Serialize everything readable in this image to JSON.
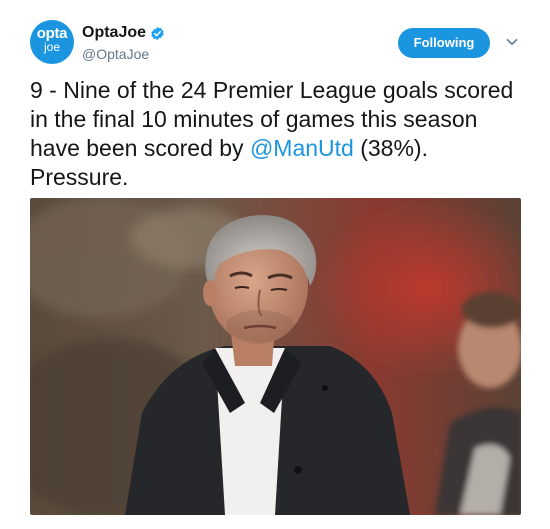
{
  "account": {
    "avatar_top": "opta",
    "avatar_bottom": "joe",
    "display_name": "OptaJoe",
    "handle": "@OptaJoe",
    "verified_icon": "verified-badge-icon"
  },
  "actions": {
    "follow_label": "Following",
    "menu_icon": "chevron-down-icon"
  },
  "tweet": {
    "text_before": "9 - Nine of the 24 Premier League goals scored in the final 10 minutes of games this season have been scored by ",
    "mention": "@ManUtd",
    "text_after": " (38%). Pressure."
  },
  "colors": {
    "accent": "#1b95e0",
    "text": "#14171a",
    "secondary_text": "#657786"
  }
}
